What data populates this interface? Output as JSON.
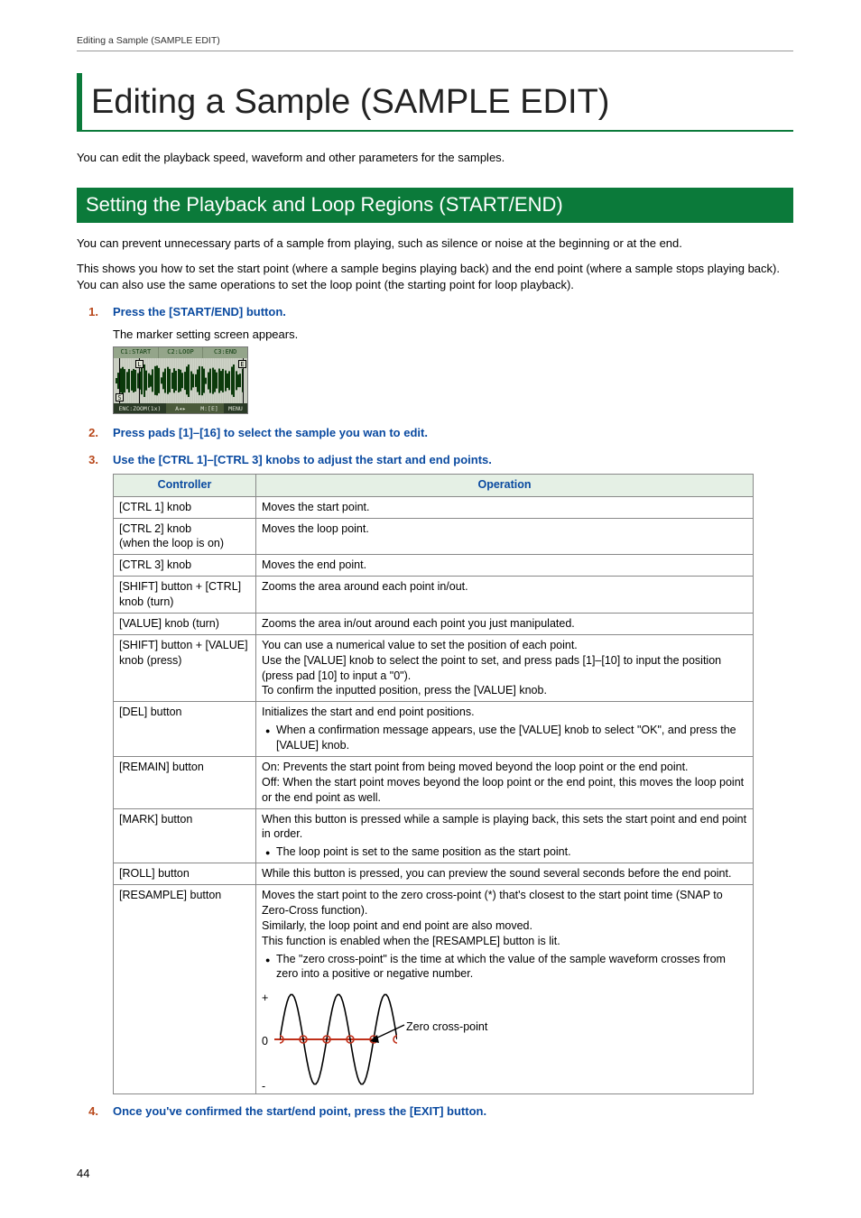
{
  "running_head": "Editing a Sample (SAMPLE EDIT)",
  "chapter_title": "Editing a Sample (SAMPLE EDIT)",
  "intro": "You can edit the playback speed, waveform and other parameters for the samples.",
  "section_title": "Setting the Playback and Loop Regions (START/END)",
  "para1": "You can prevent unnecessary parts of a sample from playing, such as silence or noise at the beginning or at the end.",
  "para2": "This shows you how to set the start point (where a sample begins playing back) and the end point (where a sample stops playing back). You can also use the same operations to set the loop point (the starting point for loop playback).",
  "steps": {
    "s1_num": "1.",
    "s1_txt": "Press the [START/END] button.",
    "s1_body": "The marker setting screen appears.",
    "s2_num": "2.",
    "s2_txt": "Press pads [1]–[16] to select the sample you wan to edit.",
    "s3_num": "3.",
    "s3_txt": "Use the [CTRL 1]–[CTRL 3] knobs to adjust the start and end points.",
    "s4_num": "4.",
    "s4_txt": "Once you've confirmed the start/end point, press the [EXIT] button."
  },
  "screenshot": {
    "tab1": "C1:START",
    "tab2": "C2:LOOP",
    "tab3": "C3:END",
    "s": "S",
    "l": "L",
    "e": "E",
    "foot_l": "ENC:ZOOM(1x)",
    "foot_a": "A◂▸",
    "foot_m": "M:[E]",
    "foot_menu": "MENU"
  },
  "table": {
    "h_controller": "Controller",
    "h_operation": "Operation",
    "rows": [
      {
        "c": "[CTRL 1] knob",
        "op": "Moves the start point."
      },
      {
        "c": "[CTRL 2] knob\n(when the loop is on)",
        "op": "Moves the loop point."
      },
      {
        "c": "[CTRL 3] knob",
        "op": "Moves the end point."
      },
      {
        "c": "[SHIFT] button + [CTRL] knob (turn)",
        "op": "Zooms the area around each point in/out."
      },
      {
        "c": "[VALUE] knob (turn)",
        "op": "Zooms the area in/out around each point you just manipulated."
      },
      {
        "c": "[SHIFT] button + [VALUE] knob (press)",
        "op_lines": [
          "You can use a numerical value to set the position of each point.",
          "Use the [VALUE] knob to select the point to set, and press pads [1]–[10] to input the position (press pad [10] to input a \"0\").",
          "To confirm the inputted position, press the [VALUE] knob."
        ]
      },
      {
        "c": "[DEL] button",
        "op": "Initializes the start and end point positions.",
        "bullet": "When a confirmation message appears, use the [VALUE] knob to select \"OK\", and press the [VALUE] knob."
      },
      {
        "c": "[REMAIN] button",
        "op_lines": [
          "On: Prevents the start point from being moved beyond the loop point or the end point.",
          "Off: When the start point moves beyond the loop point or the end point, this moves the loop point or the end point as well."
        ]
      },
      {
        "c": "[MARK] button",
        "op": "When this button is pressed while a sample is playing back, this sets the start point and end point in order.",
        "bullet": "The loop point is set to the same position as the start point."
      },
      {
        "c": "[ROLL] button",
        "op": "While this button is pressed, you can preview the sound several seconds before the end point."
      },
      {
        "c": "[RESAMPLE] button",
        "op_lines": [
          "Moves the start point to the zero cross-point (*) that's closest to the start point time (SNAP to Zero-Cross function).",
          "Similarly, the loop point and end point are also moved.",
          "This function is enabled when the [RESAMPLE] button is lit."
        ],
        "bullet": "The \"zero cross-point\" is the time at which the value of the sample waveform crosses from zero into a positive or negative number.",
        "diagram": {
          "plus": "+",
          "zero": "0",
          "minus": "-",
          "label": "Zero cross-point"
        }
      }
    ]
  },
  "page_number": "44"
}
